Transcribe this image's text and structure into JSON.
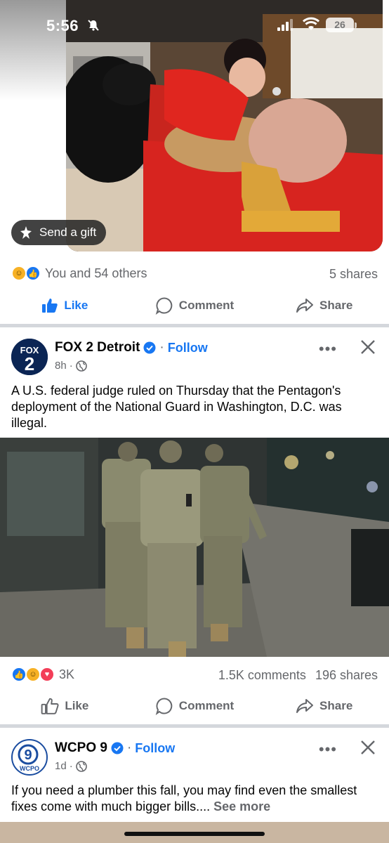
{
  "status_bar": {
    "time": "5:56",
    "battery": "26",
    "icons": [
      "bell-off-icon",
      "signal-icon",
      "wifi-icon",
      "battery-icon"
    ]
  },
  "post1": {
    "image_description_alt": "",
    "send_gift_label": "Send a gift",
    "reactions_label": "You and 54 others",
    "shares_label": "5 shares",
    "actions": {
      "like": "Like",
      "comment": "Comment",
      "share": "Share"
    }
  },
  "post2": {
    "page_name": "FOX 2 Detroit",
    "avatar_top": "FOX",
    "avatar_bottom": "2",
    "follow_label": "Follow",
    "separator": "·",
    "time": "8h",
    "text": "A U.S. federal judge ruled on Thursday that the Pentagon's deployment of the National Guard in Washington, D.C. was illegal.",
    "reactions_count": "3K",
    "comments_label": "1.5K comments",
    "shares_label": "196 shares",
    "actions": {
      "like": "Like",
      "comment": "Comment",
      "share": "Share"
    }
  },
  "post3": {
    "page_name": "WCPO 9",
    "avatar_number": "9",
    "avatar_label": "WCPO",
    "follow_label": "Follow",
    "separator": "·",
    "time": "1d",
    "text": "If you need a plumber this fall, you may find even the smallest fixes come with much bigger bills....",
    "see_more": "See more"
  },
  "colors": {
    "accent": "#1877f2",
    "secondary_text": "#65676b",
    "divider": "#d4d7dc",
    "love": "#f33e58",
    "haha": "#f7b125"
  }
}
